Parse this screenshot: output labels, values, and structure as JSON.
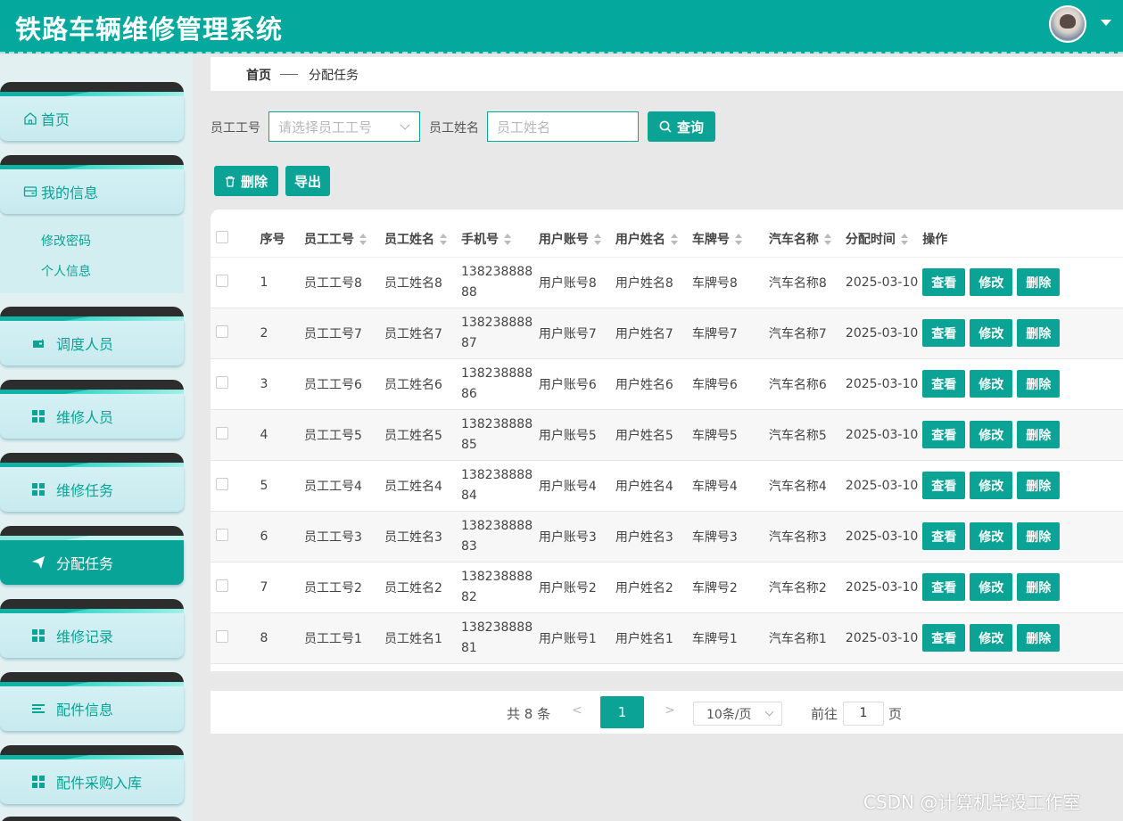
{
  "header": {
    "title": "铁路车辆维修管理系统"
  },
  "sidebar": {
    "items": [
      {
        "label": "首页",
        "icon": "home-icon"
      },
      {
        "label": "我的信息",
        "icon": "wallet-icon"
      },
      {
        "label": "调度人员",
        "icon": "wallet-icon"
      },
      {
        "label": "维修人员",
        "icon": "grid-icon"
      },
      {
        "label": "维修任务",
        "icon": "grid-icon"
      },
      {
        "label": "分配任务",
        "icon": "send-icon"
      },
      {
        "label": "维修记录",
        "icon": "grid-icon"
      },
      {
        "label": "配件信息",
        "icon": "list-icon"
      },
      {
        "label": "配件采购入库",
        "icon": "grid-icon"
      }
    ],
    "submenu": [
      "修改密码",
      "个人信息"
    ]
  },
  "breadcrumb": {
    "home": "首页",
    "current": "分配任务"
  },
  "search": {
    "emp_no_label": "员工工号",
    "emp_no_placeholder": "请选择员工工号",
    "emp_name_label": "员工姓名",
    "emp_name_placeholder": "员工姓名",
    "query_label": "查询"
  },
  "toolbar": {
    "delete_label": "删除",
    "export_label": "导出"
  },
  "table": {
    "headers": [
      "序号",
      "员工工号",
      "员工姓名",
      "手机号",
      "用户账号",
      "用户姓名",
      "车牌号",
      "汽车名称",
      "分配时间",
      "操作"
    ],
    "rows": [
      [
        "1",
        "员工工号8",
        "员工姓名8",
        "13823888888",
        "用户账号8",
        "用户姓名8",
        "车牌号8",
        "汽车名称8",
        "2025-03-10"
      ],
      [
        "2",
        "员工工号7",
        "员工姓名7",
        "13823888887",
        "用户账号7",
        "用户姓名7",
        "车牌号7",
        "汽车名称7",
        "2025-03-10"
      ],
      [
        "3",
        "员工工号6",
        "员工姓名6",
        "13823888886",
        "用户账号6",
        "用户姓名6",
        "车牌号6",
        "汽车名称6",
        "2025-03-10"
      ],
      [
        "4",
        "员工工号5",
        "员工姓名5",
        "13823888885",
        "用户账号5",
        "用户姓名5",
        "车牌号5",
        "汽车名称5",
        "2025-03-10"
      ],
      [
        "5",
        "员工工号4",
        "员工姓名4",
        "13823888884",
        "用户账号4",
        "用户姓名4",
        "车牌号4",
        "汽车名称4",
        "2025-03-10"
      ],
      [
        "6",
        "员工工号3",
        "员工姓名3",
        "13823888883",
        "用户账号3",
        "用户姓名3",
        "车牌号3",
        "汽车名称3",
        "2025-03-10"
      ],
      [
        "7",
        "员工工号2",
        "员工姓名2",
        "13823888882",
        "用户账号2",
        "用户姓名2",
        "车牌号2",
        "汽车名称2",
        "2025-03-10"
      ],
      [
        "8",
        "员工工号1",
        "员工姓名1",
        "13823888881",
        "用户账号1",
        "用户姓名1",
        "车牌号1",
        "汽车名称1",
        "2025-03-10"
      ]
    ],
    "actions": [
      "查看",
      "修改",
      "删除"
    ]
  },
  "pagination": {
    "total": "共 8 条",
    "prev": "<",
    "next": ">",
    "current_page": "1",
    "page_size": "10条/页",
    "goto_label": "前往",
    "goto_value": "1",
    "goto_unit": "页"
  },
  "watermark": "CSDN @计算机毕设工作室",
  "colors": {
    "primary": "#05a89c",
    "sidebar_bg": "#e2f0f2"
  }
}
